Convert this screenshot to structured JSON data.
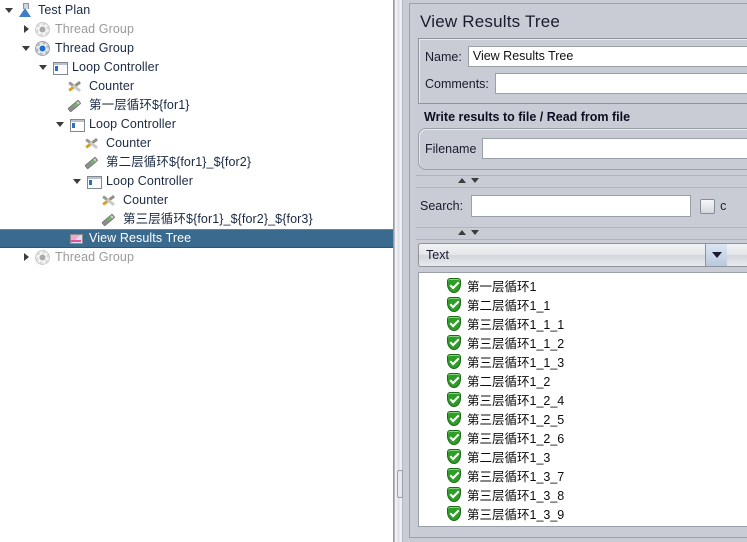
{
  "tree": {
    "rows": [
      {
        "label": "Test Plan",
        "indent": 0,
        "twisty": "open",
        "icon": "flask-icon",
        "dim": false,
        "selected": false
      },
      {
        "label": "Thread Group",
        "indent": 1,
        "twisty": "closed",
        "icon": "thread-group-icon",
        "dim": true,
        "selected": false
      },
      {
        "label": "Thread Group",
        "indent": 1,
        "twisty": "open",
        "icon": "thread-group-icon",
        "dim": false,
        "selected": false
      },
      {
        "label": "Loop Controller",
        "indent": 2,
        "twisty": "open",
        "icon": "loop-controller-icon",
        "dim": false,
        "selected": false
      },
      {
        "label": "Counter",
        "indent": 3,
        "twisty": "none",
        "icon": "counter-icon",
        "dim": false,
        "selected": false
      },
      {
        "label": "第一层循环${for1}",
        "indent": 3,
        "twisty": "none",
        "icon": "sampler-icon",
        "dim": false,
        "selected": false
      },
      {
        "label": "Loop Controller",
        "indent": 3,
        "twisty": "open",
        "icon": "loop-controller-icon",
        "dim": false,
        "selected": false
      },
      {
        "label": "Counter",
        "indent": 4,
        "twisty": "none",
        "icon": "counter-icon",
        "dim": false,
        "selected": false
      },
      {
        "label": "第二层循环${for1}_${for2}",
        "indent": 4,
        "twisty": "none",
        "icon": "sampler-icon",
        "dim": false,
        "selected": false
      },
      {
        "label": "Loop Controller",
        "indent": 4,
        "twisty": "open",
        "icon": "loop-controller-icon",
        "dim": false,
        "selected": false
      },
      {
        "label": "Counter",
        "indent": 5,
        "twisty": "none",
        "icon": "counter-icon",
        "dim": false,
        "selected": false
      },
      {
        "label": "第三层循环${for1}_${for2}_${for3}",
        "indent": 5,
        "twisty": "none",
        "icon": "sampler-icon",
        "dim": false,
        "selected": false
      },
      {
        "label": "View Results Tree",
        "indent": 3,
        "twisty": "none",
        "icon": "view-results-tree-icon",
        "dim": false,
        "selected": true
      },
      {
        "label": "Thread Group",
        "indent": 1,
        "twisty": "closed",
        "icon": "thread-group-icon",
        "dim": true,
        "selected": false
      }
    ]
  },
  "panel": {
    "title": "View Results Tree",
    "name_label": "Name:",
    "name_value": "View Results Tree",
    "comments_label": "Comments:",
    "comments_value": "",
    "comments_placeholder": "",
    "file_section_title": "Write results to file / Read from file",
    "filename_label": "Filename",
    "filename_value": "",
    "filename_placeholder": "",
    "search_label": "Search:",
    "search_value": "",
    "search_placeholder": "",
    "case_sensitive_label": "c",
    "renderer_selected": "Text",
    "renderer_options": [
      "Text"
    ]
  },
  "results": {
    "items": [
      {
        "status": "success-icon",
        "label": "第一层循环1"
      },
      {
        "status": "success-icon",
        "label": "第二层循环1_1"
      },
      {
        "status": "success-icon",
        "label": "第三层循环1_1_1"
      },
      {
        "status": "success-icon",
        "label": "第三层循环1_1_2"
      },
      {
        "status": "success-icon",
        "label": "第三层循环1_1_3"
      },
      {
        "status": "success-icon",
        "label": "第二层循环1_2"
      },
      {
        "status": "success-icon",
        "label": "第三层循环1_2_4"
      },
      {
        "status": "success-icon",
        "label": "第三层循环1_2_5"
      },
      {
        "status": "success-icon",
        "label": "第三层循环1_2_6"
      },
      {
        "status": "success-icon",
        "label": "第二层循环1_3"
      },
      {
        "status": "success-icon",
        "label": "第三层循环1_3_7"
      },
      {
        "status": "success-icon",
        "label": "第三层循环1_3_8"
      },
      {
        "status": "success-icon",
        "label": "第三层循环1_3_9"
      }
    ]
  },
  "colors": {
    "selection": "#3a6a8e",
    "panel_bg": "#c9ccd4",
    "tree_bg": "#ffffff",
    "success_green": "#2f9e28",
    "tree_text": "#1a2a44",
    "disabled_text": "#9a9a9a"
  }
}
